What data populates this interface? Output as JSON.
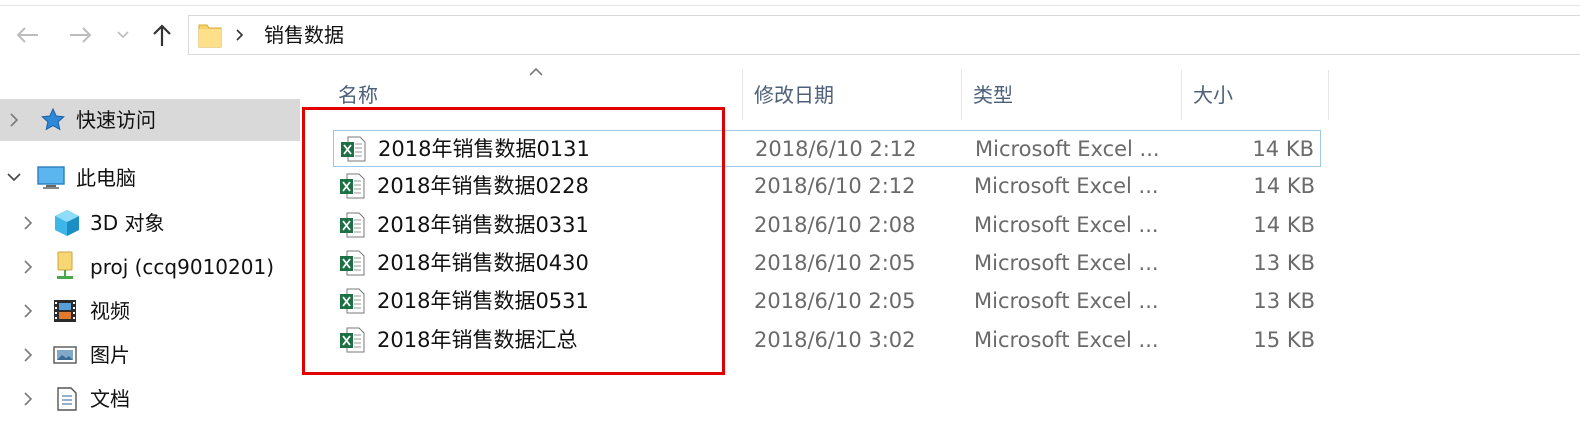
{
  "address_bar": {
    "crumb": "销售数据"
  },
  "nav_pane": {
    "items": [
      {
        "label": "快速访问",
        "icon": "star-icon",
        "expanded": false,
        "selected": true
      },
      {
        "label": "此电脑",
        "icon": "computer-icon",
        "expanded": true,
        "selected": false
      },
      {
        "label": "3D 对象",
        "icon": "cube-3d-icon",
        "expanded": false,
        "selected": false
      },
      {
        "label": "proj (ccq9010201)",
        "icon": "network-drive-icon",
        "expanded": false,
        "selected": false
      },
      {
        "label": "视频",
        "icon": "film-icon",
        "expanded": false,
        "selected": false
      },
      {
        "label": "图片",
        "icon": "picture-icon",
        "expanded": false,
        "selected": false
      },
      {
        "label": "文档",
        "icon": "document-icon",
        "expanded": false,
        "selected": false
      }
    ]
  },
  "file_list": {
    "columns": {
      "name": "名称",
      "date": "修改日期",
      "type": "类型",
      "size": "大小"
    },
    "rows": [
      {
        "name": "2018年销售数据0131",
        "date": "2018/6/10 2:12",
        "type": "Microsoft Excel ...",
        "size": "14 KB"
      },
      {
        "name": "2018年销售数据0228",
        "date": "2018/6/10 2:12",
        "type": "Microsoft Excel ...",
        "size": "14 KB"
      },
      {
        "name": "2018年销售数据0331",
        "date": "2018/6/10 2:08",
        "type": "Microsoft Excel ...",
        "size": "14 KB"
      },
      {
        "name": "2018年销售数据0430",
        "date": "2018/6/10 2:05",
        "type": "Microsoft Excel ...",
        "size": "13 KB"
      },
      {
        "name": "2018年销售数据0531",
        "date": "2018/6/10 2:05",
        "type": "Microsoft Excel ...",
        "size": "13 KB"
      },
      {
        "name": "2018年销售数据汇总",
        "date": "2018/6/10 3:02",
        "type": "Microsoft Excel ...",
        "size": "15 KB"
      }
    ]
  },
  "colors": {
    "highlight_box": "#e00000",
    "header_text": "#4c607a",
    "excel_green": "#1d7044",
    "focus_border": "#9ec7ea"
  }
}
